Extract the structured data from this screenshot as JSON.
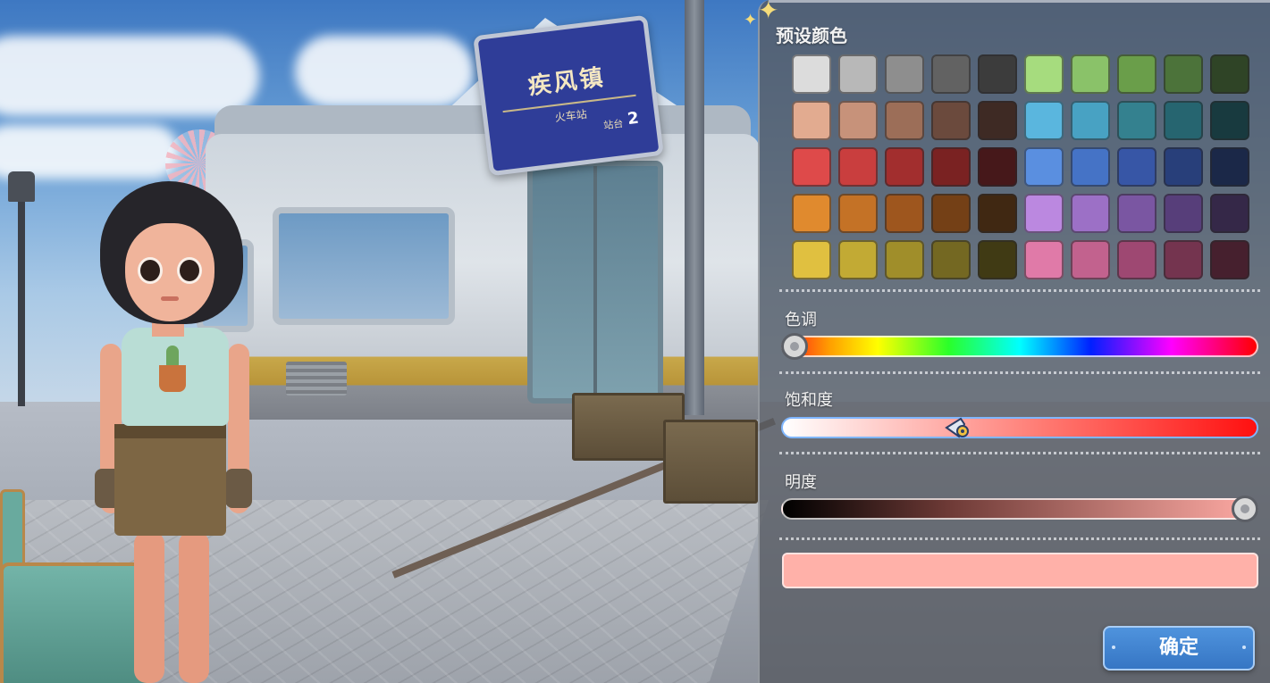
{
  "scene": {
    "station_sign": {
      "name": "疾风镇",
      "subtitle": "火车站",
      "platform_label": "站台",
      "platform_number": "2"
    }
  },
  "color_panel": {
    "presets_label": "预设颜色",
    "presets": [
      [
        "#dcdcdc",
        "#b8b8b8",
        "#8e8e8e",
        "#626262",
        "#3c3c3c",
        "#a6dc7e",
        "#8ac269",
        "#6a9e4a",
        "#4c733a",
        "#2f4426"
      ],
      [
        "#e2ab90",
        "#c7927a",
        "#9c6e58",
        "#6b4a3d",
        "#3e2a24",
        "#5ab6de",
        "#48a2c3",
        "#34818f",
        "#266570",
        "#183a3f"
      ],
      [
        "#de4a4a",
        "#c93e3e",
        "#a22e2e",
        "#7a2222",
        "#46181a",
        "#5a8fe0",
        "#4573c6",
        "#3756a6",
        "#283f7a",
        "#1b2848"
      ],
      [
        "#e08a2e",
        "#c47226",
        "#9e561e",
        "#744016",
        "#402812",
        "#bb88e0",
        "#9c70c6",
        "#7a56a2",
        "#573e7a",
        "#352848"
      ],
      [
        "#e0c040",
        "#c2aa34",
        "#a08e2a",
        "#746822",
        "#403a14",
        "#e07aa8",
        "#c2628e",
        "#9e4872",
        "#74344f",
        "#46202e"
      ]
    ],
    "hue_label": "色调",
    "hue_value": 0.0,
    "saturation_label": "饱和度",
    "saturation_value": 0.37,
    "brightness_label": "明度",
    "brightness_value": 1.0,
    "current_color": "#ffb1a9",
    "confirm_label": "确定",
    "accent_color": "#3a7dcf"
  }
}
